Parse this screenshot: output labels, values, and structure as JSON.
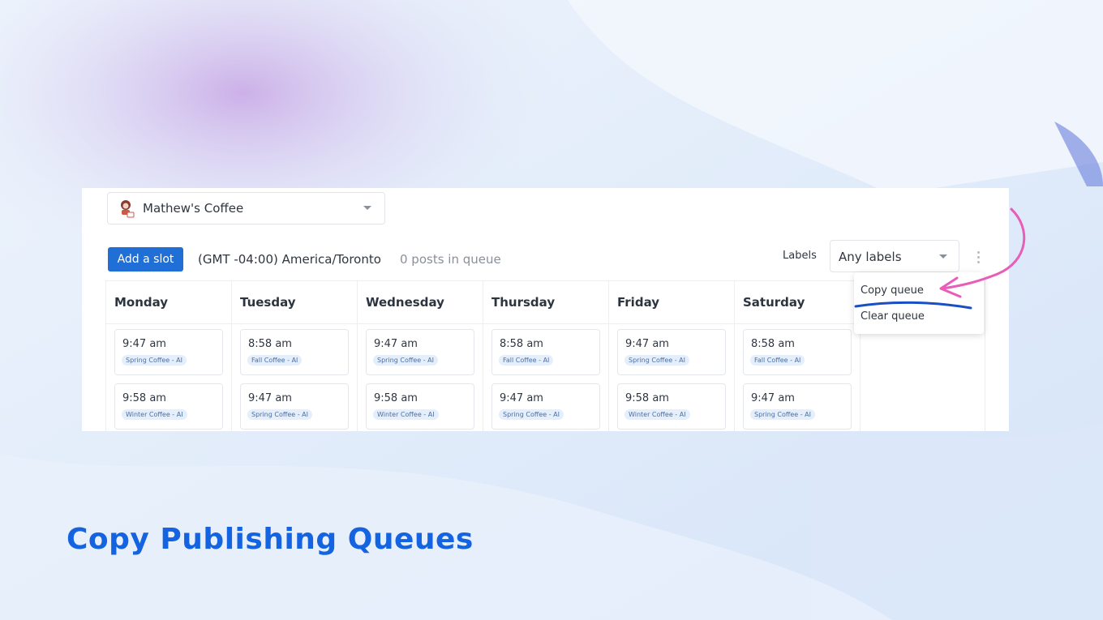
{
  "account": {
    "name": "Mathew's Coffee"
  },
  "toolbar": {
    "add_slot_label": "Add a slot",
    "timezone": "(GMT -04:00) America/Toronto",
    "queue_count": "0 posts in queue",
    "labels_label": "Labels",
    "labels_value": "Any labels"
  },
  "menu": {
    "copy_queue": "Copy queue",
    "clear_queue": "Clear queue"
  },
  "days": [
    {
      "name": "Monday",
      "slots": [
        {
          "time": "9:47 am",
          "label": "Spring Coffee - AI"
        },
        {
          "time": "9:58 am",
          "label": "Winter Coffee - AI"
        }
      ]
    },
    {
      "name": "Tuesday",
      "slots": [
        {
          "time": "8:58 am",
          "label": "Fall Coffee - AI"
        },
        {
          "time": "9:47 am",
          "label": "Spring Coffee - AI"
        }
      ]
    },
    {
      "name": "Wednesday",
      "slots": [
        {
          "time": "9:47 am",
          "label": "Spring Coffee - AI"
        },
        {
          "time": "9:58 am",
          "label": "Winter Coffee - AI"
        }
      ]
    },
    {
      "name": "Thursday",
      "slots": [
        {
          "time": "8:58 am",
          "label": "Fall Coffee - AI"
        },
        {
          "time": "9:47 am",
          "label": "Spring Coffee - AI"
        }
      ]
    },
    {
      "name": "Friday",
      "slots": [
        {
          "time": "9:47 am",
          "label": "Spring Coffee - AI"
        },
        {
          "time": "9:58 am",
          "label": "Winter Coffee - AI"
        }
      ]
    },
    {
      "name": "Saturday",
      "slots": [
        {
          "time": "8:58 am",
          "label": "Fall Coffee - AI"
        },
        {
          "time": "9:47 am",
          "label": "Spring Coffee - AI"
        }
      ]
    }
  ],
  "headline": "Copy Publishing Queues",
  "colors": {
    "primary": "#1f6fd6",
    "headline": "#1463e0",
    "arrow": "#e85db8",
    "underline": "#1a4fc4",
    "label_bg": "#e5eefb"
  },
  "icons": {
    "account_avatar": "avatar-icon",
    "more_menu": "more-vertical-icon",
    "arrow": "arrow-annotation-icon"
  }
}
